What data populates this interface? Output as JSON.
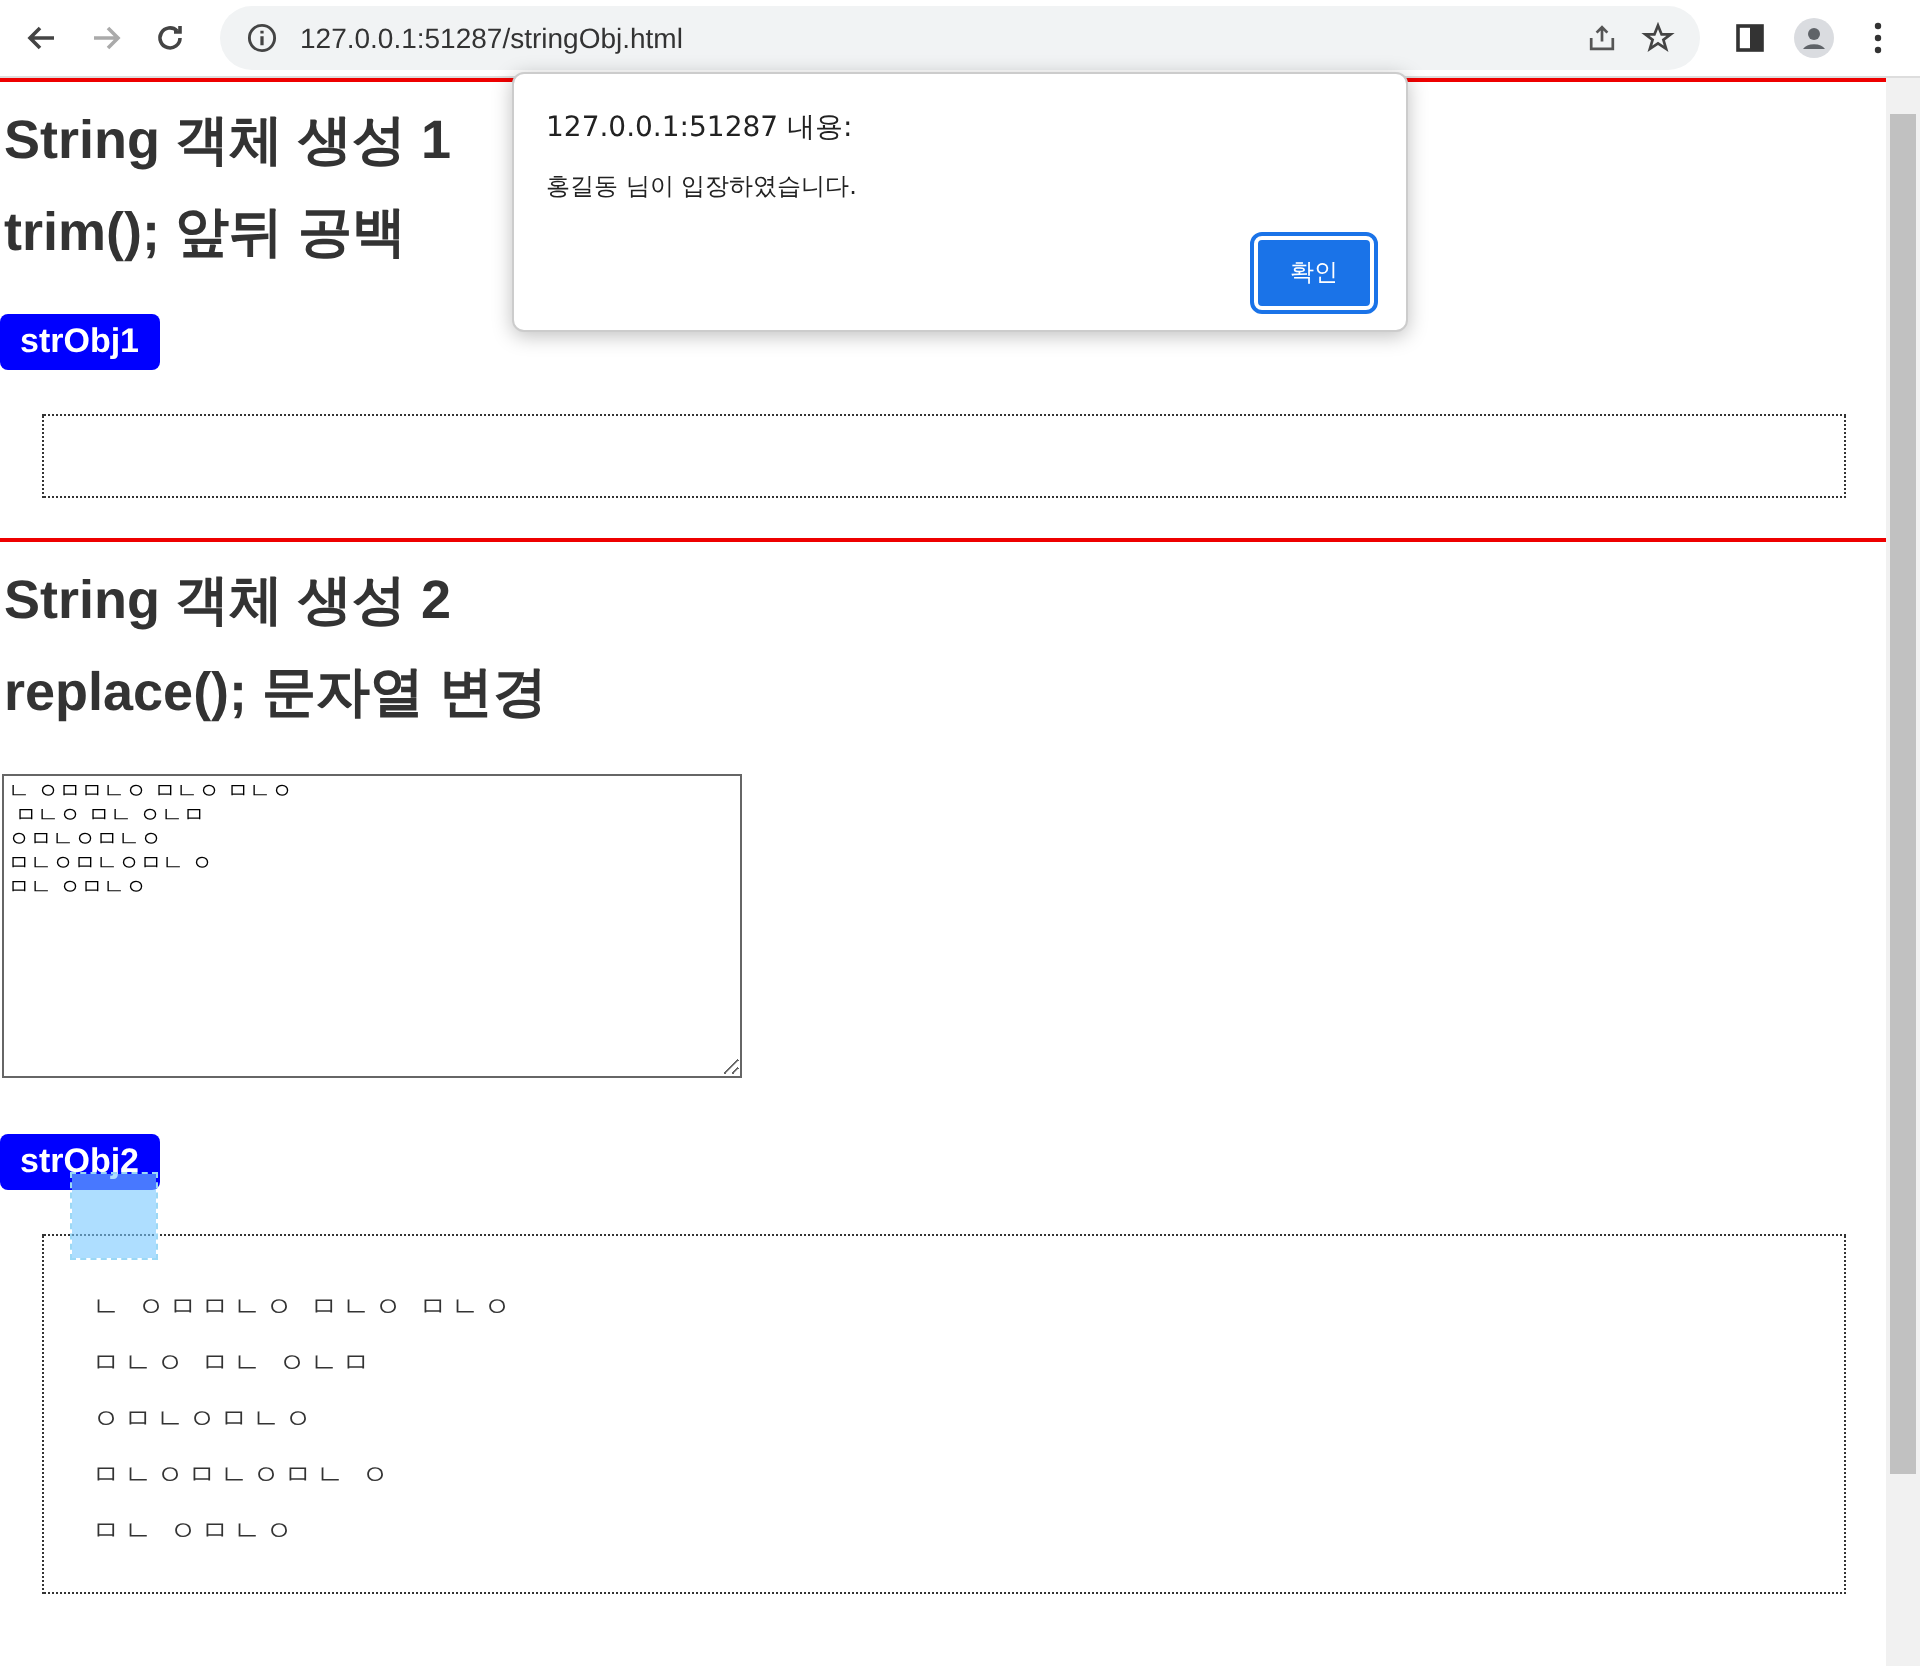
{
  "browser": {
    "url": "127.0.0.1:51287/stringObj.html"
  },
  "dialog": {
    "title": "127.0.0.1:51287 내용:",
    "message": "홍길동 님이 입장하였습니다.",
    "button": "확인"
  },
  "section_1": {
    "heading_lines": [
      "String 객체 생성 1",
      "trim(); 앞뒤 공백"
    ],
    "button": "strObj1"
  },
  "section_2": {
    "heading_lines": [
      "String 객체 생성 2",
      "replace(); 문자열 변경"
    ],
    "textarea_lines": [
      "ㄴ ㅇㅁㅁㄴㅇ ㅁㄴㅇ ㅁㄴㅇ",
      " ㅁㄴㅇ ㅁㄴ ㅇㄴㅁ",
      "ㅇㅁㄴㅇㅁㄴㅇ",
      "ㅁㄴㅇㅁㄴㅇㅁㄴ ㅇ",
      "ㅁㄴ ㅇㅁㄴㅇ"
    ],
    "button": "strObj2",
    "output_lines": [
      "ㄴ ㅇㅁㅁㄴㅇ ㅁㄴㅇ ㅁㄴㅇ",
      "ㅁㄴㅇ ㅁㄴ ㅇㄴㅁ",
      "ㅇㅁㄴㅇㅁㄴㅇ",
      "ㅁㄴㅇㅁㄴㅇㅁㄴ ㅇ",
      "ㅁㄴ ㅇㅁㄴㅇ"
    ]
  }
}
